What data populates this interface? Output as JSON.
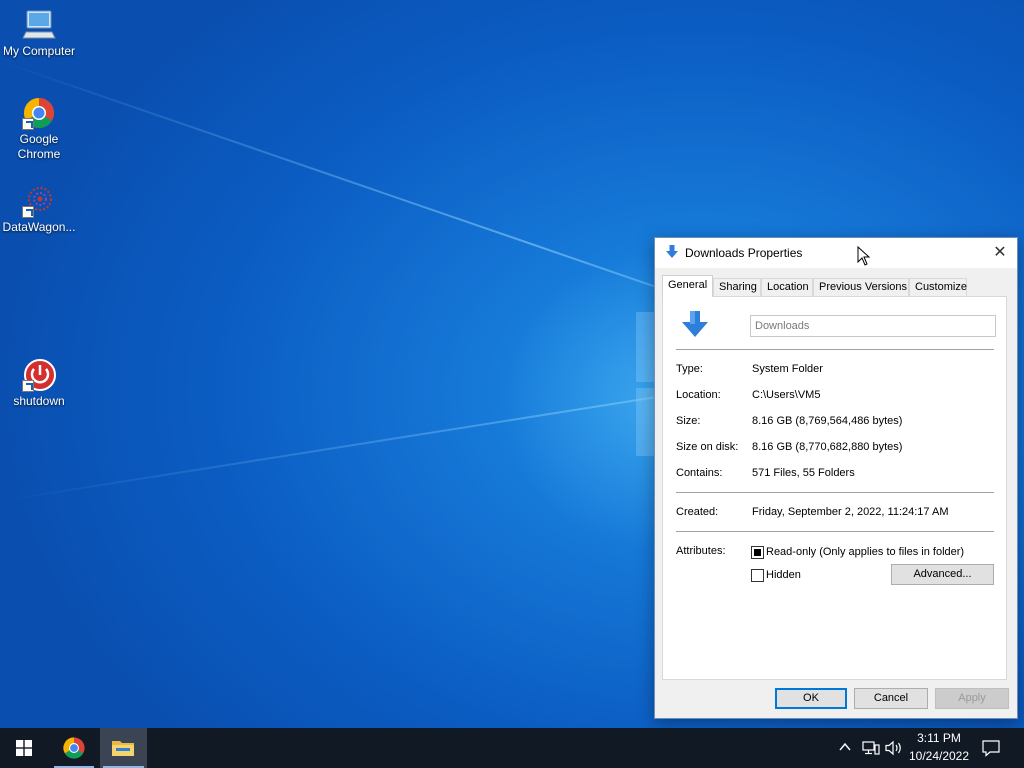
{
  "desktop": {
    "icons": [
      {
        "label": "My Computer",
        "icon": "monitor-icon"
      },
      {
        "label": "Google Chrome",
        "icon": "chrome-icon"
      },
      {
        "label": "DataWagon...",
        "icon": "datawagon-icon"
      },
      {
        "label": "shutdown",
        "icon": "shutdown-icon"
      }
    ]
  },
  "dialog": {
    "title": "Downloads Properties",
    "close_symbol": "✕",
    "tabs": [
      {
        "label": "General",
        "active": true
      },
      {
        "label": "Sharing"
      },
      {
        "label": "Location"
      },
      {
        "label": "Previous Versions"
      },
      {
        "label": "Customize"
      }
    ],
    "general": {
      "name_value": "Downloads",
      "fields": [
        {
          "label": "Type:",
          "value": "System Folder"
        },
        {
          "label": "Location:",
          "value": "C:\\Users\\VM5"
        },
        {
          "label": "Size:",
          "value": "8.16 GB (8,769,564,486 bytes)"
        },
        {
          "label": "Size on disk:",
          "value": "8.16 GB (8,770,682,880 bytes)"
        },
        {
          "label": "Contains:",
          "value": "571 Files, 55 Folders"
        }
      ],
      "created_label": "Created:",
      "created_value": "Friday, September 2, 2022, 11:24:17 AM",
      "attributes_label": "Attributes:",
      "readonly_label": "Read-only (Only applies to files in folder)",
      "readonly_state": "indeterminate",
      "hidden_label": "Hidden",
      "hidden_checked": false,
      "advanced_label": "Advanced..."
    },
    "buttons": {
      "ok": "OK",
      "cancel": "Cancel",
      "apply": "Apply"
    }
  },
  "taskbar": {
    "items": [
      {
        "name": "start",
        "icon": "windows-logo-icon"
      },
      {
        "name": "chrome",
        "icon": "chrome-icon"
      },
      {
        "name": "file-explorer",
        "icon": "folder-icon",
        "active": true
      }
    ],
    "tray": {
      "time": "3:11 PM",
      "date": "10/24/2022"
    }
  },
  "colors": {
    "accent": "#0078d7",
    "taskbar": "#101924",
    "desktop": "#1576d6"
  }
}
